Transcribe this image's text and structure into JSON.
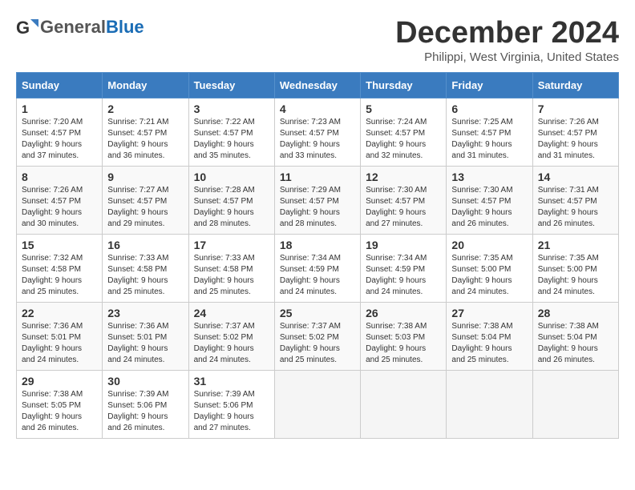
{
  "logo": {
    "general": "General",
    "blue": "Blue"
  },
  "title": "December 2024",
  "location": "Philippi, West Virginia, United States",
  "days_of_week": [
    "Sunday",
    "Monday",
    "Tuesday",
    "Wednesday",
    "Thursday",
    "Friday",
    "Saturday"
  ],
  "weeks": [
    [
      {
        "day": 1,
        "sunrise": "7:20 AM",
        "sunset": "4:57 PM",
        "daylight": "9 hours and 37 minutes."
      },
      {
        "day": 2,
        "sunrise": "7:21 AM",
        "sunset": "4:57 PM",
        "daylight": "9 hours and 36 minutes."
      },
      {
        "day": 3,
        "sunrise": "7:22 AM",
        "sunset": "4:57 PM",
        "daylight": "9 hours and 35 minutes."
      },
      {
        "day": 4,
        "sunrise": "7:23 AM",
        "sunset": "4:57 PM",
        "daylight": "9 hours and 33 minutes."
      },
      {
        "day": 5,
        "sunrise": "7:24 AM",
        "sunset": "4:57 PM",
        "daylight": "9 hours and 32 minutes."
      },
      {
        "day": 6,
        "sunrise": "7:25 AM",
        "sunset": "4:57 PM",
        "daylight": "9 hours and 31 minutes."
      },
      {
        "day": 7,
        "sunrise": "7:26 AM",
        "sunset": "4:57 PM",
        "daylight": "9 hours and 31 minutes."
      }
    ],
    [
      {
        "day": 8,
        "sunrise": "7:26 AM",
        "sunset": "4:57 PM",
        "daylight": "9 hours and 30 minutes."
      },
      {
        "day": 9,
        "sunrise": "7:27 AM",
        "sunset": "4:57 PM",
        "daylight": "9 hours and 29 minutes."
      },
      {
        "day": 10,
        "sunrise": "7:28 AM",
        "sunset": "4:57 PM",
        "daylight": "9 hours and 28 minutes."
      },
      {
        "day": 11,
        "sunrise": "7:29 AM",
        "sunset": "4:57 PM",
        "daylight": "9 hours and 28 minutes."
      },
      {
        "day": 12,
        "sunrise": "7:30 AM",
        "sunset": "4:57 PM",
        "daylight": "9 hours and 27 minutes."
      },
      {
        "day": 13,
        "sunrise": "7:30 AM",
        "sunset": "4:57 PM",
        "daylight": "9 hours and 26 minutes."
      },
      {
        "day": 14,
        "sunrise": "7:31 AM",
        "sunset": "4:57 PM",
        "daylight": "9 hours and 26 minutes."
      }
    ],
    [
      {
        "day": 15,
        "sunrise": "7:32 AM",
        "sunset": "4:58 PM",
        "daylight": "9 hours and 25 minutes."
      },
      {
        "day": 16,
        "sunrise": "7:33 AM",
        "sunset": "4:58 PM",
        "daylight": "9 hours and 25 minutes."
      },
      {
        "day": 17,
        "sunrise": "7:33 AM",
        "sunset": "4:58 PM",
        "daylight": "9 hours and 25 minutes."
      },
      {
        "day": 18,
        "sunrise": "7:34 AM",
        "sunset": "4:59 PM",
        "daylight": "9 hours and 24 minutes."
      },
      {
        "day": 19,
        "sunrise": "7:34 AM",
        "sunset": "4:59 PM",
        "daylight": "9 hours and 24 minutes."
      },
      {
        "day": 20,
        "sunrise": "7:35 AM",
        "sunset": "5:00 PM",
        "daylight": "9 hours and 24 minutes."
      },
      {
        "day": 21,
        "sunrise": "7:35 AM",
        "sunset": "5:00 PM",
        "daylight": "9 hours and 24 minutes."
      }
    ],
    [
      {
        "day": 22,
        "sunrise": "7:36 AM",
        "sunset": "5:01 PM",
        "daylight": "9 hours and 24 minutes."
      },
      {
        "day": 23,
        "sunrise": "7:36 AM",
        "sunset": "5:01 PM",
        "daylight": "9 hours and 24 minutes."
      },
      {
        "day": 24,
        "sunrise": "7:37 AM",
        "sunset": "5:02 PM",
        "daylight": "9 hours and 24 minutes."
      },
      {
        "day": 25,
        "sunrise": "7:37 AM",
        "sunset": "5:02 PM",
        "daylight": "9 hours and 25 minutes."
      },
      {
        "day": 26,
        "sunrise": "7:38 AM",
        "sunset": "5:03 PM",
        "daylight": "9 hours and 25 minutes."
      },
      {
        "day": 27,
        "sunrise": "7:38 AM",
        "sunset": "5:04 PM",
        "daylight": "9 hours and 25 minutes."
      },
      {
        "day": 28,
        "sunrise": "7:38 AM",
        "sunset": "5:04 PM",
        "daylight": "9 hours and 26 minutes."
      }
    ],
    [
      {
        "day": 29,
        "sunrise": "7:38 AM",
        "sunset": "5:05 PM",
        "daylight": "9 hours and 26 minutes."
      },
      {
        "day": 30,
        "sunrise": "7:39 AM",
        "sunset": "5:06 PM",
        "daylight": "9 hours and 26 minutes."
      },
      {
        "day": 31,
        "sunrise": "7:39 AM",
        "sunset": "5:06 PM",
        "daylight": "9 hours and 27 minutes."
      },
      null,
      null,
      null,
      null
    ]
  ]
}
